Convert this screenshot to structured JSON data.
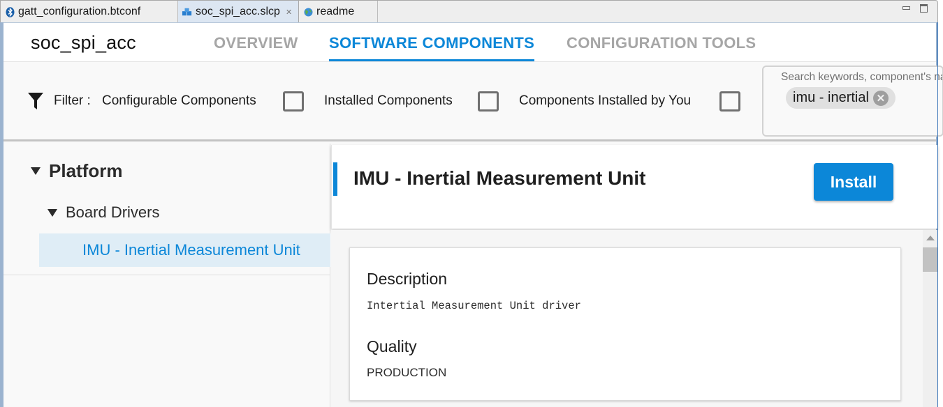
{
  "editor_tabs": [
    {
      "label": "gatt_configuration.btconf",
      "icon": "bluetooth-icon",
      "active": false
    },
    {
      "label": "soc_spi_acc.slcp",
      "icon": "components-icon",
      "active": true,
      "close": "✕"
    },
    {
      "label": "readme",
      "icon": "globe-icon",
      "active": false
    }
  ],
  "header": {
    "project_name": "soc_spi_acc",
    "nav_tabs": [
      {
        "label": "OVERVIEW",
        "active": false
      },
      {
        "label": "SOFTWARE COMPONENTS",
        "active": true
      },
      {
        "label": "CONFIGURATION TOOLS",
        "active": false
      }
    ]
  },
  "filter": {
    "label": "Filter :",
    "options": [
      {
        "label": "Configurable Components",
        "checked": false
      },
      {
        "label": "Installed Components",
        "checked": false
      },
      {
        "label": "Components Installed by You",
        "checked": false
      }
    ],
    "search": {
      "placeholder": "Search keywords, component's name",
      "chips": [
        {
          "label": "imu - inertial",
          "remove": "✕"
        }
      ]
    }
  },
  "tree": {
    "category": "Platform",
    "subcategory": "Board Drivers",
    "selected_item": "IMU - Inertial Measurement Unit"
  },
  "detail": {
    "title": "IMU - Inertial Measurement Unit",
    "install_label": "Install",
    "sections": [
      {
        "title": "Description",
        "value": "Intertial Measurement Unit driver"
      },
      {
        "title": "Quality",
        "value": "PRODUCTION"
      }
    ]
  },
  "colors": {
    "accent": "#0c87d8",
    "selected_row_bg": "#dfedf6"
  }
}
